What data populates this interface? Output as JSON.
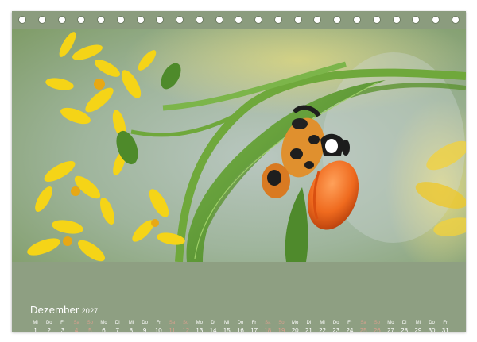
{
  "calendar": {
    "month": "Dezember",
    "year": "2027",
    "days": [
      {
        "wd": "Mi",
        "d": "1",
        "weekend": false
      },
      {
        "wd": "Do",
        "d": "2",
        "weekend": false
      },
      {
        "wd": "Fr",
        "d": "3",
        "weekend": false
      },
      {
        "wd": "Sa",
        "d": "4",
        "weekend": true
      },
      {
        "wd": "So",
        "d": "5",
        "weekend": true
      },
      {
        "wd": "Mo",
        "d": "6",
        "weekend": false
      },
      {
        "wd": "Di",
        "d": "7",
        "weekend": false
      },
      {
        "wd": "Mi",
        "d": "8",
        "weekend": false
      },
      {
        "wd": "Do",
        "d": "9",
        "weekend": false
      },
      {
        "wd": "Fr",
        "d": "10",
        "weekend": false
      },
      {
        "wd": "Sa",
        "d": "11",
        "weekend": true
      },
      {
        "wd": "So",
        "d": "12",
        "weekend": true
      },
      {
        "wd": "Mo",
        "d": "13",
        "weekend": false
      },
      {
        "wd": "Di",
        "d": "14",
        "weekend": false
      },
      {
        "wd": "Mi",
        "d": "15",
        "weekend": false
      },
      {
        "wd": "Do",
        "d": "16",
        "weekend": false
      },
      {
        "wd": "Fr",
        "d": "17",
        "weekend": false
      },
      {
        "wd": "Sa",
        "d": "18",
        "weekend": true
      },
      {
        "wd": "So",
        "d": "19",
        "weekend": true
      },
      {
        "wd": "Mo",
        "d": "20",
        "weekend": false
      },
      {
        "wd": "Di",
        "d": "21",
        "weekend": false
      },
      {
        "wd": "Mi",
        "d": "22",
        "weekend": false
      },
      {
        "wd": "Do",
        "d": "23",
        "weekend": false
      },
      {
        "wd": "Fr",
        "d": "24",
        "weekend": false
      },
      {
        "wd": "Sa",
        "d": "25",
        "weekend": true
      },
      {
        "wd": "So",
        "d": "26",
        "weekend": true
      },
      {
        "wd": "Mo",
        "d": "27",
        "weekend": false
      },
      {
        "wd": "Di",
        "d": "28",
        "weekend": false
      },
      {
        "wd": "Mi",
        "d": "29",
        "weekend": false
      },
      {
        "wd": "Do",
        "d": "30",
        "weekend": false
      },
      {
        "wd": "Fr",
        "d": "31",
        "weekend": false
      }
    ]
  },
  "colors": {
    "footer_bg": "#8e9f82",
    "weekend_text": "#d9a08e",
    "text": "#ffffff"
  },
  "binding_ring_count": 23
}
